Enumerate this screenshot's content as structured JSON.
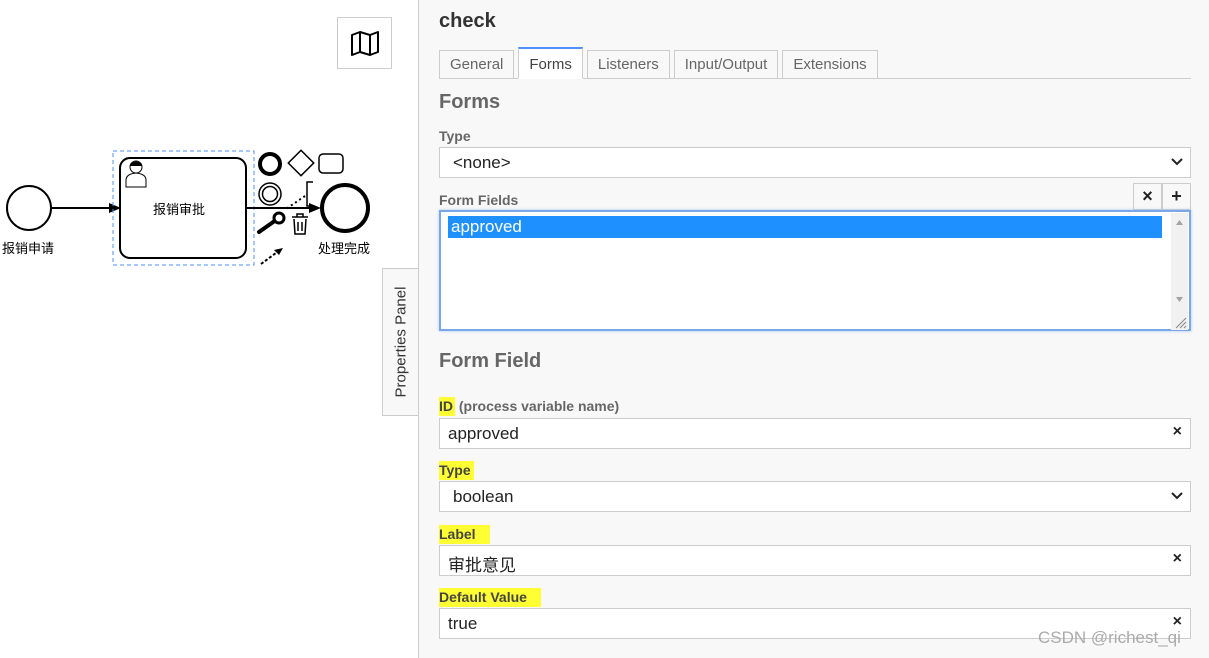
{
  "diagram": {
    "start_event_label": "报销申请",
    "task_label": "报销审批",
    "end_event_label": "处理完成"
  },
  "panel_tab": {
    "label": "Properties Panel"
  },
  "panel": {
    "title": "check",
    "tabs": [
      {
        "label": "General",
        "active": false
      },
      {
        "label": "Forms",
        "active": true
      },
      {
        "label": "Listeners",
        "active": false
      },
      {
        "label": "Input/Output",
        "active": false
      },
      {
        "label": "Extensions",
        "active": false
      }
    ],
    "forms_section": {
      "title": "Forms",
      "type_label": "Type",
      "type_value": "<none>",
      "form_fields_label": "Form Fields",
      "remove_button": "×",
      "add_button": "+",
      "form_fields": [
        "approved"
      ]
    },
    "form_field_section": {
      "title": "Form Field",
      "id_label_highlight": "ID",
      "id_label_rest": " (process variable name)",
      "id_value": "approved",
      "type_label": "Type",
      "type_value": "boolean",
      "label_label": "Label",
      "label_value": "审批意见",
      "default_value_label": "Default Value",
      "default_value": "true",
      "clear_glyph": "×"
    }
  },
  "watermark": "CSDN @richest_qi",
  "colors": {
    "highlight": "#ffff33",
    "selection": "#1e90ff",
    "focus_border": "#7aa7e8",
    "active_tab_top": "#4d90fe"
  }
}
